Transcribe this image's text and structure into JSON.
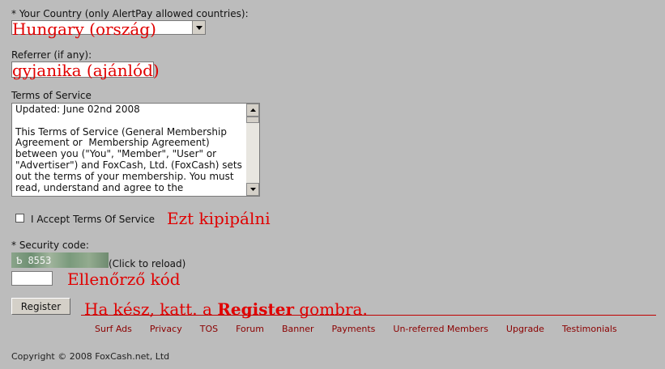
{
  "form": {
    "country_label": "* Your Country (only AlertPay allowed countries):",
    "country_value": "",
    "referrer_label": "Referrer (if any):",
    "referrer_value": "",
    "tos_label": "Terms of Service",
    "tos_text": "Updated: June 02nd 2008\n\nThis Terms of Service (General Membership Agreement or  Membership Agreement) between you (\"You\", \"Member\", \"User\" or \"Advertiser\") and FoxCash, Ltd. (FoxCash) sets out the terms of your membership. You must read, understand and agree to the",
    "accept_label": "I Accept Terms Of Service",
    "security_label": "* Security code:",
    "captcha_text": "Ƅ 8553",
    "reload_label": "(Click to reload)",
    "register_label": "Register"
  },
  "annotations": {
    "country": "Hungary (ország)",
    "referrer": "gyjanika (ajánlód)",
    "checkbox": "Ezt kipipálni",
    "code": "Ellenőrző kód",
    "register_pre": "Ha kész, katt. a ",
    "register_bold": "Register",
    "register_post": " gombra."
  },
  "footer": {
    "links": [
      "Surf Ads",
      "Privacy",
      "TOS",
      "Forum",
      "Banner",
      "Payments",
      "Un-referred Members",
      "Upgrade",
      "Testimonials"
    ],
    "copyright": "Copyright © 2008 FoxCash.net, Ltd"
  },
  "colors": {
    "background": "#bcbcbc",
    "annotation": "#e00000",
    "footer_link": "#8b0000"
  }
}
